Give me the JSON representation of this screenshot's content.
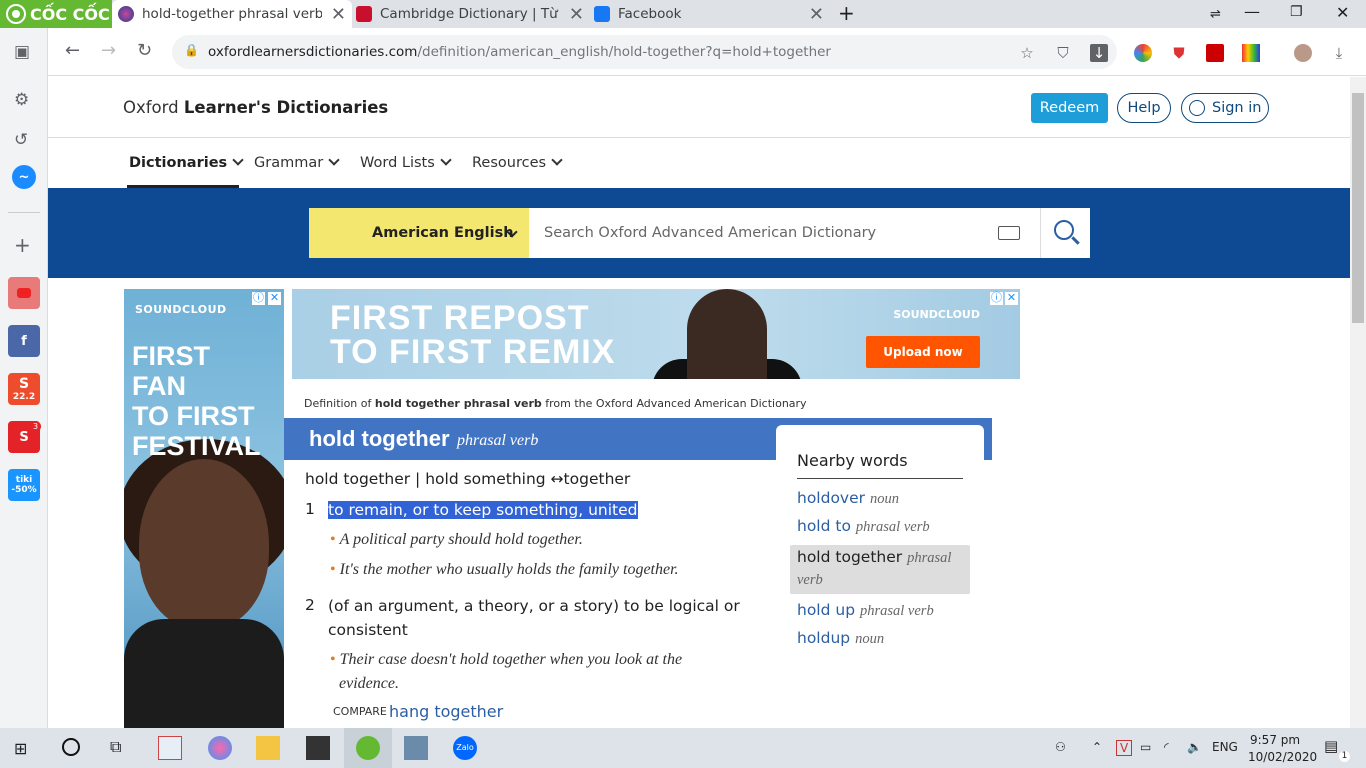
{
  "browser": {
    "brand": "CỐC CỐC",
    "tabs": [
      {
        "title": "hold-together phrasal verb - O",
        "active": true
      },
      {
        "title": "Cambridge Dictionary | Từ điể",
        "active": false
      },
      {
        "title": "Facebook",
        "active": false
      }
    ],
    "url_host": "oxfordlearnersdictionaries.com",
    "url_path": "/definition/american_english/hold-together?q=hold+together"
  },
  "sidebar_badges": {
    "shopee": "22.2",
    "sendo_count": "3",
    "tiki": "tiki -50%"
  },
  "site": {
    "brand_plain": "Oxford ",
    "brand_bold": "Learner's Dictionaries",
    "redeem": "Redeem",
    "help": "Help",
    "signin": "Sign in",
    "nav": [
      "Dictionaries",
      "Grammar",
      "Word Lists",
      "Resources"
    ]
  },
  "search": {
    "dictionary": "American English",
    "placeholder": "Search Oxford Advanced American Dictionary"
  },
  "ads": {
    "left_brand": "SOUNDCLOUD",
    "left_text": [
      "FIRST",
      "FAN",
      "TO FIRST",
      "FESTIVAL"
    ],
    "top_text": [
      "FIRST REPOST",
      "TO FIRST REMIX"
    ],
    "top_brand": "SOUNDCLOUD",
    "top_button": "Upload now"
  },
  "entry": {
    "from_prefix": "Definition of ",
    "from_bold": "hold together phrasal verb",
    "from_suffix": " from the Oxford Advanced American Dictionary",
    "headword": "hold together",
    "pos": "phrasal verb",
    "forms": "hold together | hold something ↔together",
    "senses": [
      {
        "num": "1",
        "def": "to remain, or to keep something, united",
        "examples": [
          "A political party should hold together.",
          "It's the mother who usually holds the family together."
        ]
      },
      {
        "num": "2",
        "def_line1": "(of an argument, a theory, or a story) to be logical or",
        "def_line2": "consistent",
        "examples_line1": "Their case doesn't hold together when you look at the",
        "examples_line2": "evidence."
      }
    ],
    "compare_label": "COMPARE",
    "compare_link": "hang together"
  },
  "nearby": {
    "heading": "Nearby words",
    "items": [
      {
        "word": "holdover",
        "pos": "noun"
      },
      {
        "word": "hold to",
        "pos": "phrasal verb"
      },
      {
        "word": "hold together",
        "pos": "phrasal",
        "pos2": "verb",
        "selected": true
      },
      {
        "word": "hold up",
        "pos": "phrasal verb"
      },
      {
        "word": "holdup",
        "pos": "noun"
      }
    ]
  },
  "taskbar": {
    "lang": "ENG",
    "time": "9:57 pm",
    "date": "10/02/2020",
    "notif": "1"
  }
}
